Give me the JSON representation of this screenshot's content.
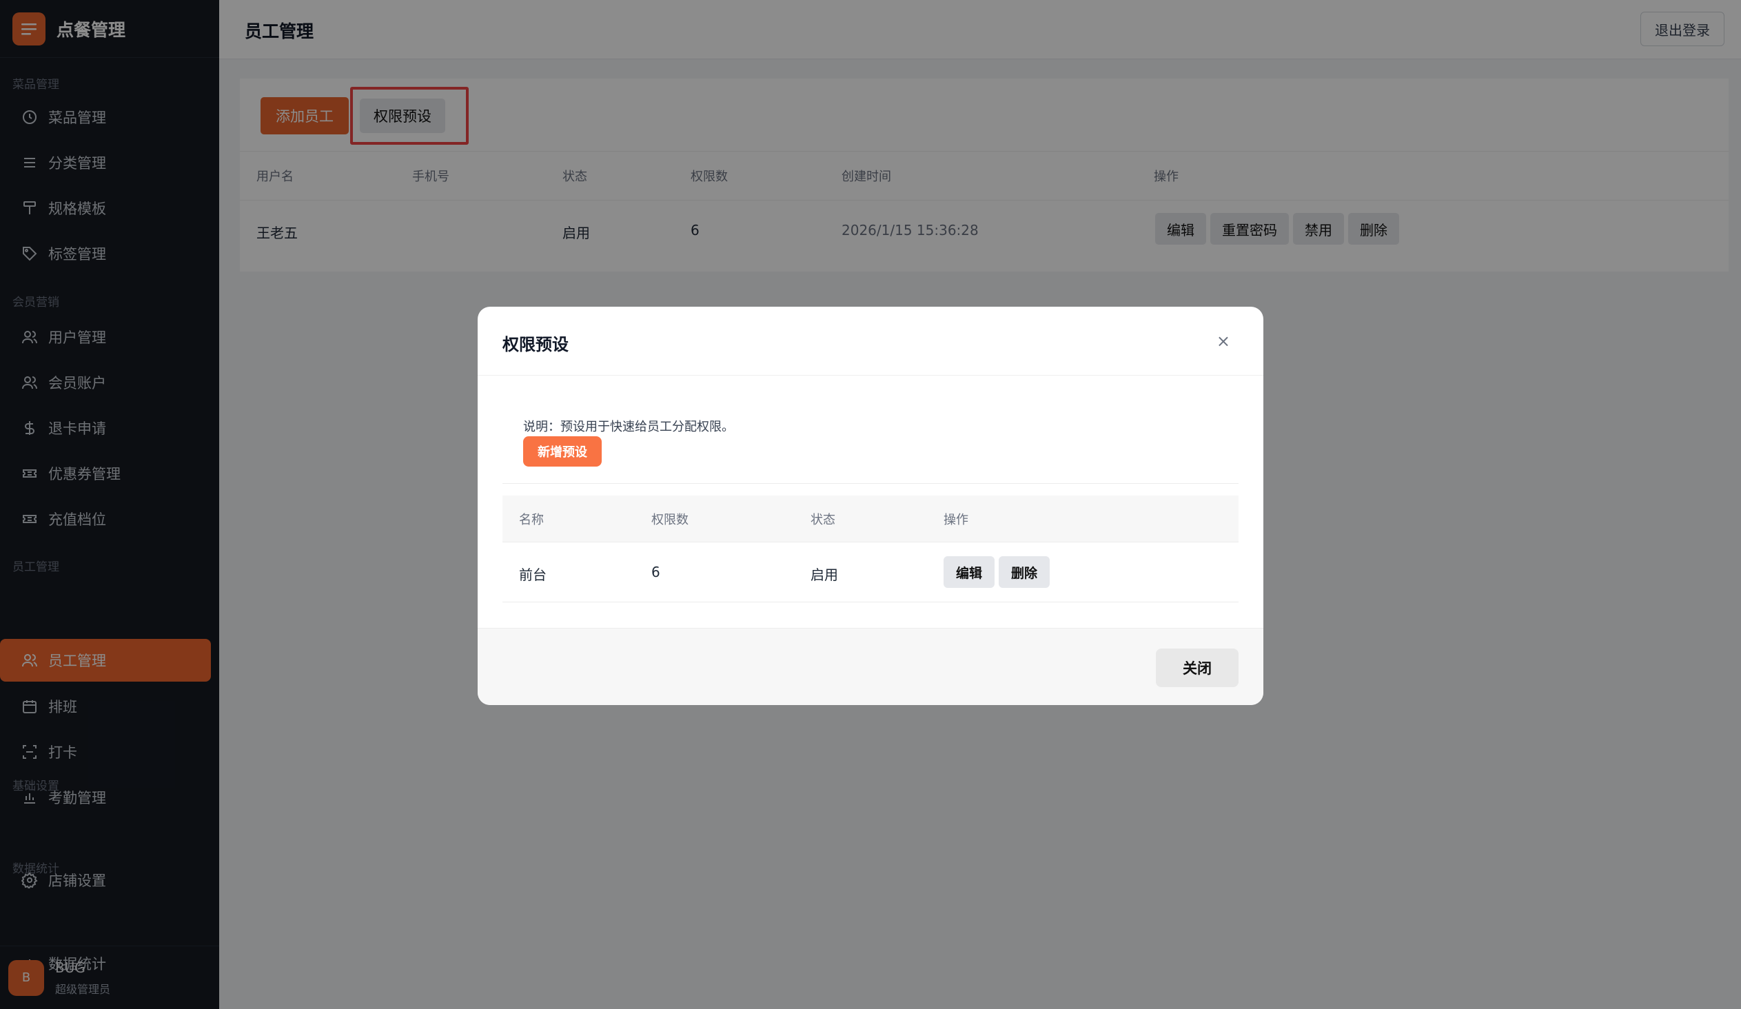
{
  "sidebar": {
    "brand": {
      "title": "点餐管理",
      "icon": "menu-icon"
    },
    "sections": [
      {
        "label": "菜品管理"
      },
      {
        "label": "会员营销"
      },
      {
        "label": "员工管理"
      },
      {
        "label": "基础设置"
      },
      {
        "label": "数据统计"
      }
    ],
    "items": [
      {
        "label": "菜品管理",
        "icon": "clock-icon"
      },
      {
        "label": "分类管理",
        "icon": "list-icon"
      },
      {
        "label": "规格模板",
        "icon": "paint-roller-icon"
      },
      {
        "label": "标签管理",
        "icon": "tag-icon"
      },
      {
        "label": "用户管理",
        "icon": "users-icon"
      },
      {
        "label": "会员账户",
        "icon": "users-icon"
      },
      {
        "label": "退卡申请",
        "icon": "dollar-icon"
      },
      {
        "label": "优惠券管理",
        "icon": "ticket-icon"
      },
      {
        "label": "充值档位",
        "icon": "ticket-icon"
      },
      {
        "label": "员工管理",
        "icon": "users-icon",
        "active": true
      },
      {
        "label": "排班",
        "icon": "calendar-icon"
      },
      {
        "label": "打卡",
        "icon": "scan-icon"
      },
      {
        "label": "考勤管理",
        "icon": "bar-chart-icon"
      },
      {
        "label": "店铺设置",
        "icon": "gear-icon"
      },
      {
        "label": "数据统计",
        "icon": "bar-chart-icon"
      }
    ],
    "user": {
      "avatar": "B",
      "name": "BUG",
      "role": "超级管理员"
    }
  },
  "header": {
    "title": "员工管理",
    "logout_label": "退出登录"
  },
  "toolbar": {
    "add_label": "添加员工",
    "preset_label": "权限预设"
  },
  "staff_table": {
    "columns": [
      "用户名",
      "手机号",
      "状态",
      "权限数",
      "创建时间",
      "操作"
    ],
    "rows": [
      {
        "username": "王老五",
        "phone": "",
        "status": "启用",
        "perm_count": "6",
        "created": "2026/1/15 15:36:28"
      }
    ],
    "actions": [
      "编辑",
      "重置密码",
      "禁用",
      "删除"
    ]
  },
  "modal": {
    "title": "权限预设",
    "close_symbol": "×",
    "description": "说明：预设用于快速给员工分配权限。",
    "new_label": "新增预设",
    "columns": [
      "名称",
      "权限数",
      "状态",
      "操作"
    ],
    "rows": [
      {
        "name": "前台",
        "perm_count": "6",
        "status": "启用"
      }
    ],
    "row_actions": [
      "编辑",
      "删除"
    ],
    "footer_close_label": "关闭"
  },
  "colors": {
    "accent": "#e8652f",
    "sidebar_bg": "#161a22",
    "highlight": "#ef4444"
  }
}
